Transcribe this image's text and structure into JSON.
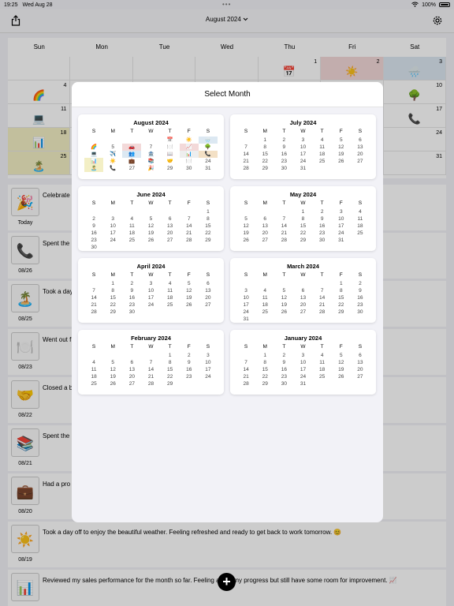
{
  "status": {
    "time": "19:25",
    "date": "Wed Aug 28",
    "battery": "100%"
  },
  "nav": {
    "title": "August 2024",
    "chevron": "chevron-down-icon"
  },
  "bg_calendar": {
    "weekdays": [
      "Sun",
      "Mon",
      "Tue",
      "Wed",
      "Thu",
      "Fri",
      "Sat"
    ],
    "cells": [
      {
        "n": "",
        "e": ""
      },
      {
        "n": "",
        "e": ""
      },
      {
        "n": "",
        "e": ""
      },
      {
        "n": "",
        "e": ""
      },
      {
        "n": "1",
        "e": "📅"
      },
      {
        "n": "2",
        "e": "☀️"
      },
      {
        "n": "3",
        "e": "🌧️"
      },
      {
        "n": "4",
        "e": "🌈"
      },
      {
        "n": "",
        "e": ""
      },
      {
        "n": "",
        "e": ""
      },
      {
        "n": "",
        "e": ""
      },
      {
        "n": "",
        "e": ""
      },
      {
        "n": "",
        "e": ""
      },
      {
        "n": "10",
        "e": "🌳"
      },
      {
        "n": "11",
        "e": "💻"
      },
      {
        "n": "",
        "e": ""
      },
      {
        "n": "",
        "e": ""
      },
      {
        "n": "",
        "e": ""
      },
      {
        "n": "",
        "e": ""
      },
      {
        "n": "",
        "e": ""
      },
      {
        "n": "17",
        "e": "📞"
      },
      {
        "n": "18",
        "e": "📊"
      },
      {
        "n": "",
        "e": ""
      },
      {
        "n": "",
        "e": ""
      },
      {
        "n": "",
        "e": ""
      },
      {
        "n": "",
        "e": ""
      },
      {
        "n": "",
        "e": ""
      },
      {
        "n": "24",
        "e": ""
      },
      {
        "n": "25",
        "e": "🏝️"
      },
      {
        "n": "",
        "e": ""
      },
      {
        "n": "",
        "e": ""
      },
      {
        "n": "",
        "e": ""
      },
      {
        "n": "",
        "e": ""
      },
      {
        "n": "",
        "e": ""
      },
      {
        "n": "31",
        "e": ""
      }
    ]
  },
  "feed": [
    {
      "emoji": "🎉",
      "date": "Today",
      "text": "Celebrate"
    },
    {
      "emoji": "📞",
      "date": "08/26",
      "text": "Spent the"
    },
    {
      "emoji": "🏝️",
      "date": "08/25",
      "text": "Took a day"
    },
    {
      "emoji": "🍽️",
      "date": "08/23",
      "text": "Went out f"
    },
    {
      "emoji": "🤝",
      "date": "08/22",
      "text": "Closed a b"
    },
    {
      "emoji": "📚",
      "date": "08/21",
      "text": "Spent the"
    },
    {
      "emoji": "💼",
      "date": "08/20",
      "text": "Had a pro"
    },
    {
      "emoji": "☀️",
      "date": "08/19",
      "text": "Took a day off to enjoy the beautiful weather. Feeling refreshed and ready to get back to work tomorrow. 😊"
    },
    {
      "emoji": "📊",
      "date": "",
      "text": "Reviewed my sales performance for the month so far. Feeling          about my progress but still have some room for improvement. 📈"
    }
  ],
  "modal": {
    "title": "Select Month",
    "weekday_initials": [
      "S",
      "M",
      "T",
      "W",
      "T",
      "F",
      "S"
    ],
    "months": [
      {
        "name": "August 2024",
        "offset": 4,
        "days": 31,
        "emojis": {
          "1": "📅",
          "2": "☀️",
          "3": "🌧️",
          "4": "🌈",
          "5": "",
          "6": "🚗",
          "7": "",
          "8": "🍽️",
          "9": "📈",
          "10": "🌳",
          "11": "💻",
          "12": "✈️",
          "13": "👥",
          "14": "🏦",
          "15": "📖",
          "16": "📊",
          "17": "📞",
          "18": "📊",
          "19": "☀️",
          "20": "💼",
          "21": "📚",
          "22": "🤝",
          "23": "🍽️",
          "25": "🏝️",
          "26": "📞",
          "28": "🎉"
        }
      },
      {
        "name": "July 2024",
        "offset": 1,
        "days": 31
      },
      {
        "name": "June 2024",
        "offset": 6,
        "days": 30
      },
      {
        "name": "May 2024",
        "offset": 3,
        "days": 31
      },
      {
        "name": "April 2024",
        "offset": 1,
        "days": 30
      },
      {
        "name": "March 2024",
        "offset": 5,
        "days": 31
      },
      {
        "name": "February 2024",
        "offset": 4,
        "days": 29
      },
      {
        "name": "January 2024",
        "offset": 1,
        "days": 31
      }
    ]
  },
  "fab": {
    "label": "+"
  },
  "colors": {
    "accent": "#000000",
    "thursday_bg": "#f3d9d9",
    "saturday_bg": "#dce8f2",
    "weekend_yellow": "#f3efc5"
  }
}
